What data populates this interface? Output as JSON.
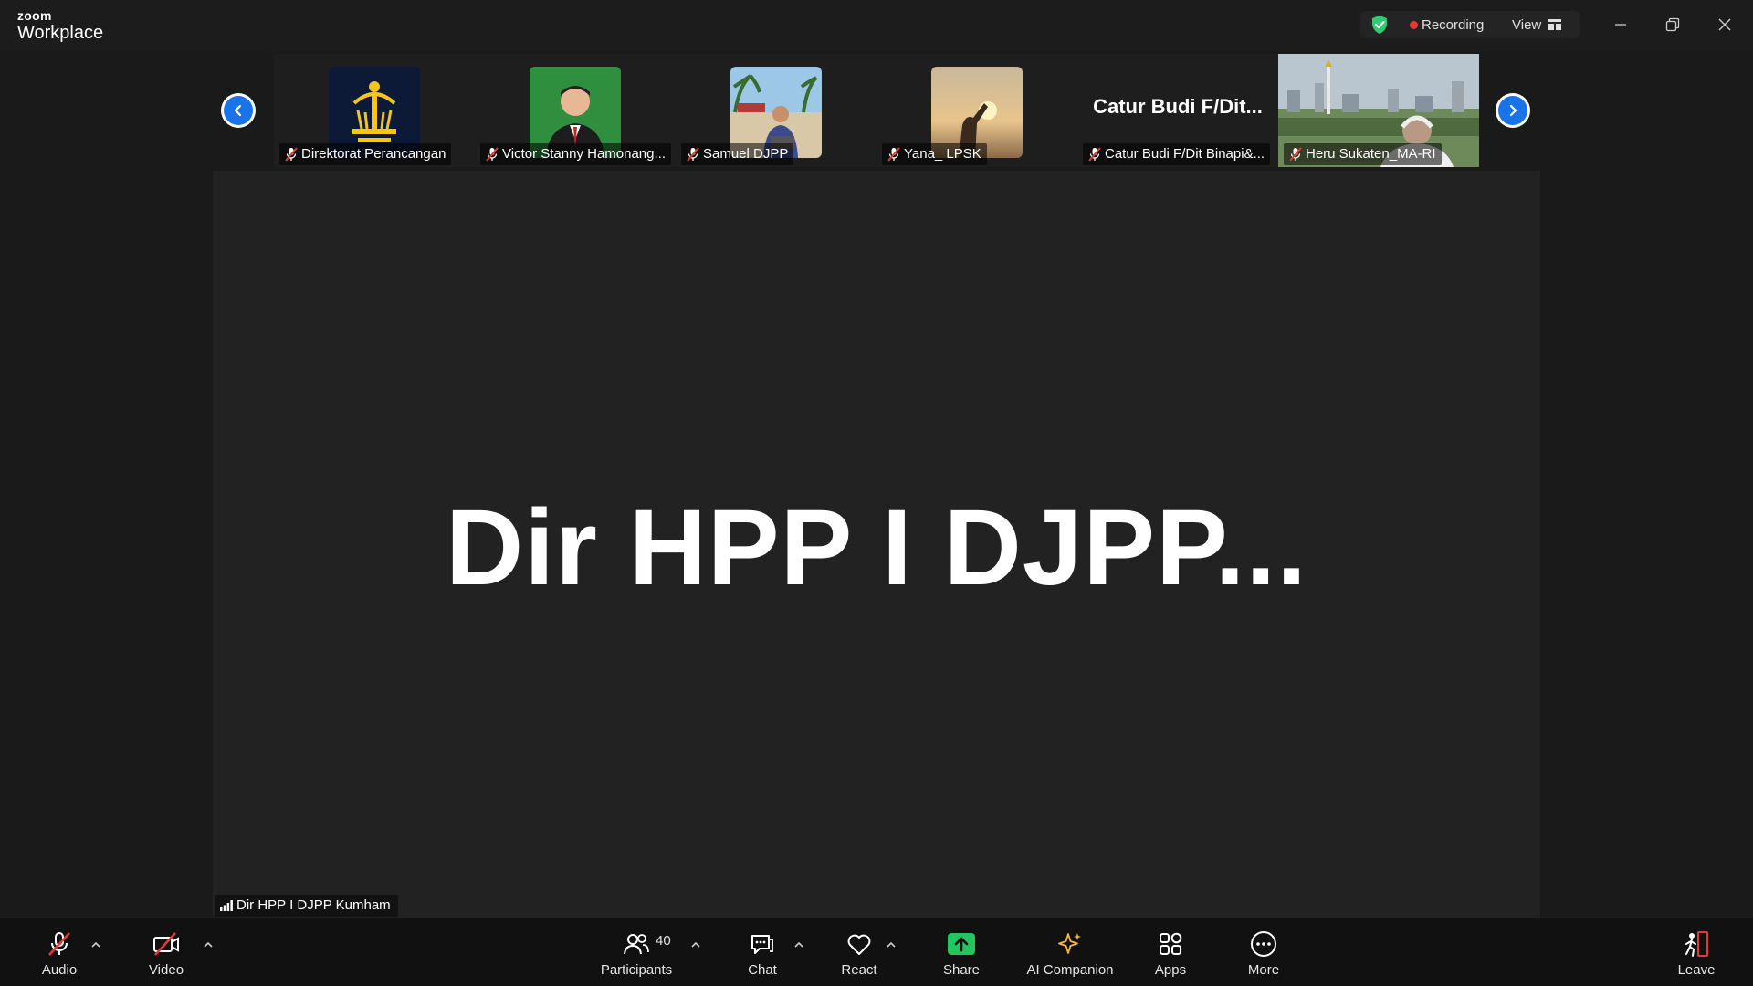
{
  "app": {
    "brand_small": "zoom",
    "brand_large": "Workplace"
  },
  "titlebar": {
    "recording_label": "Recording",
    "view_label": "View"
  },
  "gallery": {
    "participants": [
      {
        "name": "Direktorat Perancangan",
        "avatar": "emblem"
      },
      {
        "name": "Victor Stanny Hamonang...",
        "avatar": "person-green"
      },
      {
        "name": "Samuel DJPP",
        "avatar": "beach-person"
      },
      {
        "name": "Yana_ LPSK",
        "avatar": "sunset"
      },
      {
        "name": "Catur Budi F/Dit Binapi&...",
        "display_text": "Catur Budi F/Dit...",
        "avatar": "none"
      },
      {
        "name": "Heru Sukaten_MA-RI",
        "avatar": "cityscape"
      }
    ]
  },
  "stage": {
    "display_name": "Dir HPP I DJPP...",
    "label": "Dir HPP I DJPP Kumham"
  },
  "toolbar": {
    "audio": "Audio",
    "video": "Video",
    "participants": "Participants",
    "participants_count": "40",
    "chat": "Chat",
    "react": "React",
    "share": "Share",
    "ai_companion": "AI Companion",
    "apps": "Apps",
    "more": "More",
    "leave": "Leave"
  },
  "colors": {
    "accent": "#1a73e8",
    "share": "#22c55e",
    "muted_red": "#e53935",
    "recording_dot": "#e53935",
    "shield": "#2ecc71"
  }
}
